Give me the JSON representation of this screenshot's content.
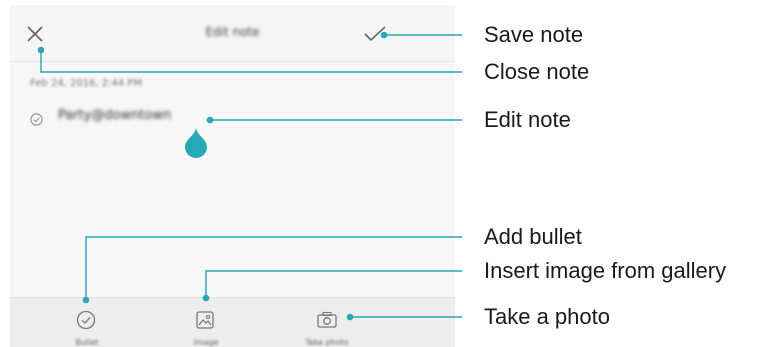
{
  "app": {
    "title": "Edit note",
    "date": "Feb 24, 2016, 2:44 PM",
    "note_text": "Party@downtown"
  },
  "toolbar": {
    "items": [
      {
        "label": "Bullet",
        "icon": "check-circle-icon"
      },
      {
        "label": "Image",
        "icon": "image-icon"
      },
      {
        "label": "Take photo",
        "icon": "camera-icon"
      }
    ]
  },
  "callouts": {
    "save_note": "Save note",
    "close_note": "Close note",
    "edit_note": "Edit note",
    "add_bullet": "Add bullet",
    "insert_image": "Insert image from gallery",
    "take_photo": "Take a photo"
  },
  "colors": {
    "accent": "#26a8b5",
    "toolbar_bg": "#ededed",
    "screen_bg": "#f7f7f7"
  }
}
